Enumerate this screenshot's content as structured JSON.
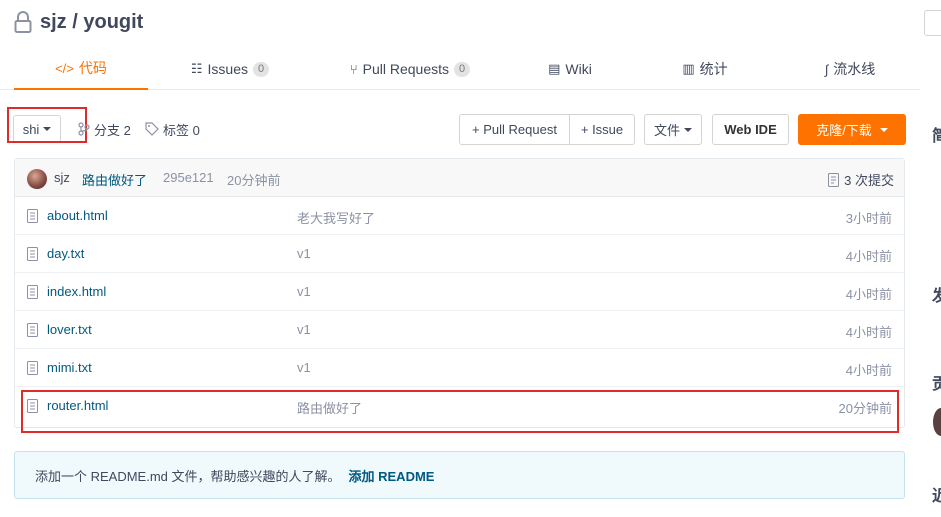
{
  "repo": {
    "title": "sjz / yougit"
  },
  "tabs": [
    {
      "label": "代码",
      "icon": "code-icon"
    },
    {
      "label": "Issues",
      "icon": "issues-icon",
      "count": "0"
    },
    {
      "label": "Pull Requests",
      "icon": "pull-request-icon",
      "count": "0"
    },
    {
      "label": "Wiki",
      "icon": "wiki-icon"
    },
    {
      "label": "统计",
      "icon": "stats-icon"
    },
    {
      "label": "流水线",
      "icon": "pipeline-icon"
    }
  ],
  "toolbar": {
    "branch": "shi",
    "branches": "分支 2",
    "tags": "标签 0",
    "pull_request": "+ Pull Request",
    "issue": "+ Issue",
    "file": "文件",
    "web_ide": "Web IDE",
    "clone": "克隆/下载"
  },
  "commit": {
    "author": "sjz",
    "message": "路由做好了",
    "hash": "295e121",
    "time": "20分钟前",
    "count": "3 次提交"
  },
  "files": [
    {
      "name": "about.html",
      "message": "老大我写好了",
      "time": "3小时前"
    },
    {
      "name": "day.txt",
      "message": "v1",
      "time": "4小时前"
    },
    {
      "name": "index.html",
      "message": "v1",
      "time": "4小时前"
    },
    {
      "name": "lover.txt",
      "message": "v1",
      "time": "4小时前"
    },
    {
      "name": "mimi.txt",
      "message": "v1",
      "time": "4小时前"
    },
    {
      "name": "router.html",
      "message": "路由做好了",
      "time": "20分钟前"
    }
  ],
  "readme": {
    "text": "添加一个 README.md 文件，帮助感兴趣的人了解。",
    "link": "添加 README"
  },
  "colors": {
    "accent": "#fe7300",
    "link": "#005980",
    "highlight": "#e02b2b"
  }
}
